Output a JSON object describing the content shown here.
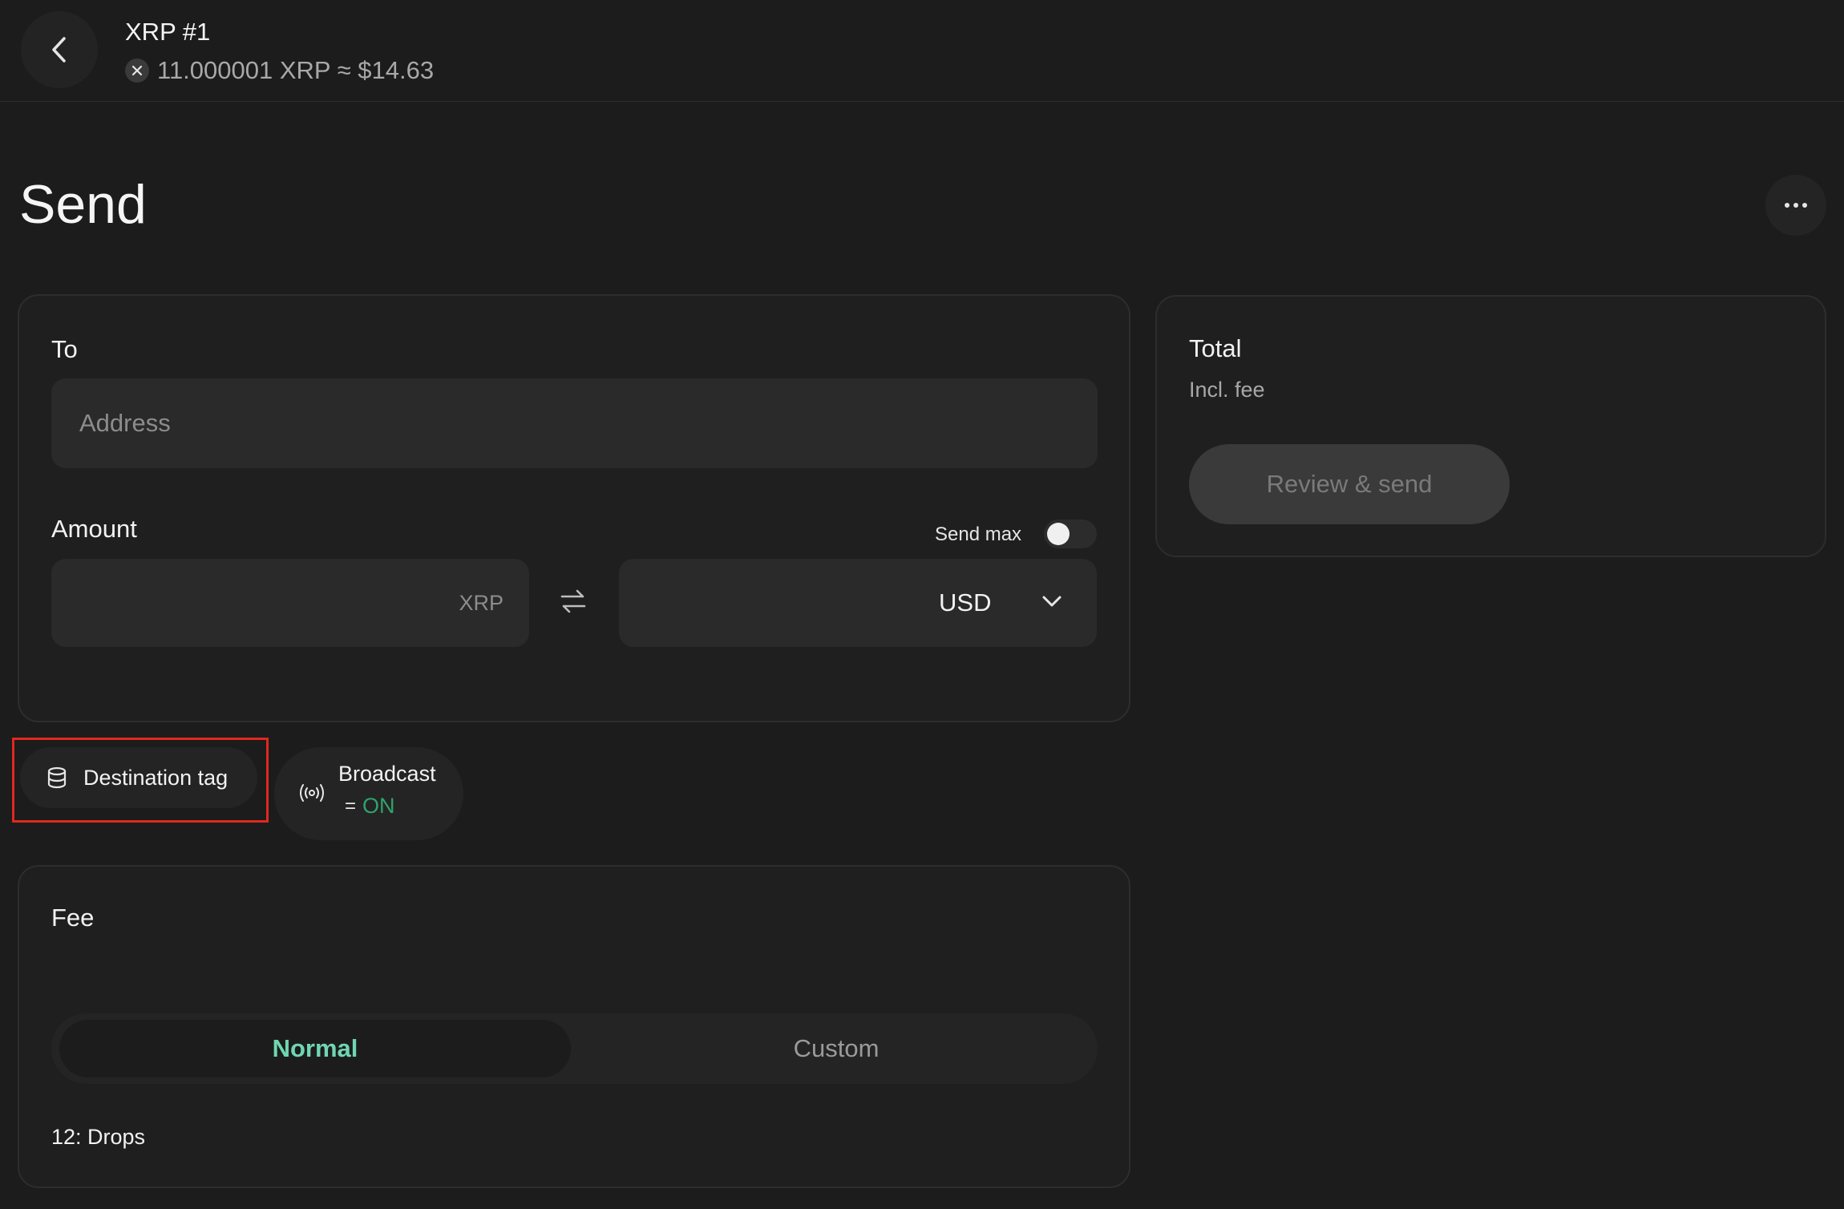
{
  "header": {
    "account_title": "XRP #1",
    "balance": "11.000001 XRP ≈ $14.63",
    "back_icon": "chevron-left-icon",
    "coin_icon": "xrp-icon"
  },
  "page": {
    "title": "Send",
    "more_icon": "more-icon"
  },
  "send_form": {
    "to_label": "To",
    "address_placeholder": "Address",
    "amount_label": "Amount",
    "send_max_label": "Send max",
    "send_max_on": false,
    "crypto_unit": "XRP",
    "swap_icon": "swap-icon",
    "fiat_currency": "USD",
    "dropdown_icon": "chevron-down-icon"
  },
  "total": {
    "title": "Total",
    "subtitle": "Incl. fee",
    "review_button": "Review & send"
  },
  "options": {
    "destination_tag": "Destination tag",
    "broadcast_label": "Broadcast",
    "broadcast_eq": "=",
    "broadcast_state": "ON"
  },
  "fee": {
    "title": "Fee",
    "tabs": [
      "Normal",
      "Custom"
    ],
    "selected": "Normal",
    "value": "12: Drops"
  },
  "colors": {
    "accent_green": "#6fd6b2",
    "broadcast_on": "#2fa36b",
    "highlight_red": "#e0281f"
  }
}
